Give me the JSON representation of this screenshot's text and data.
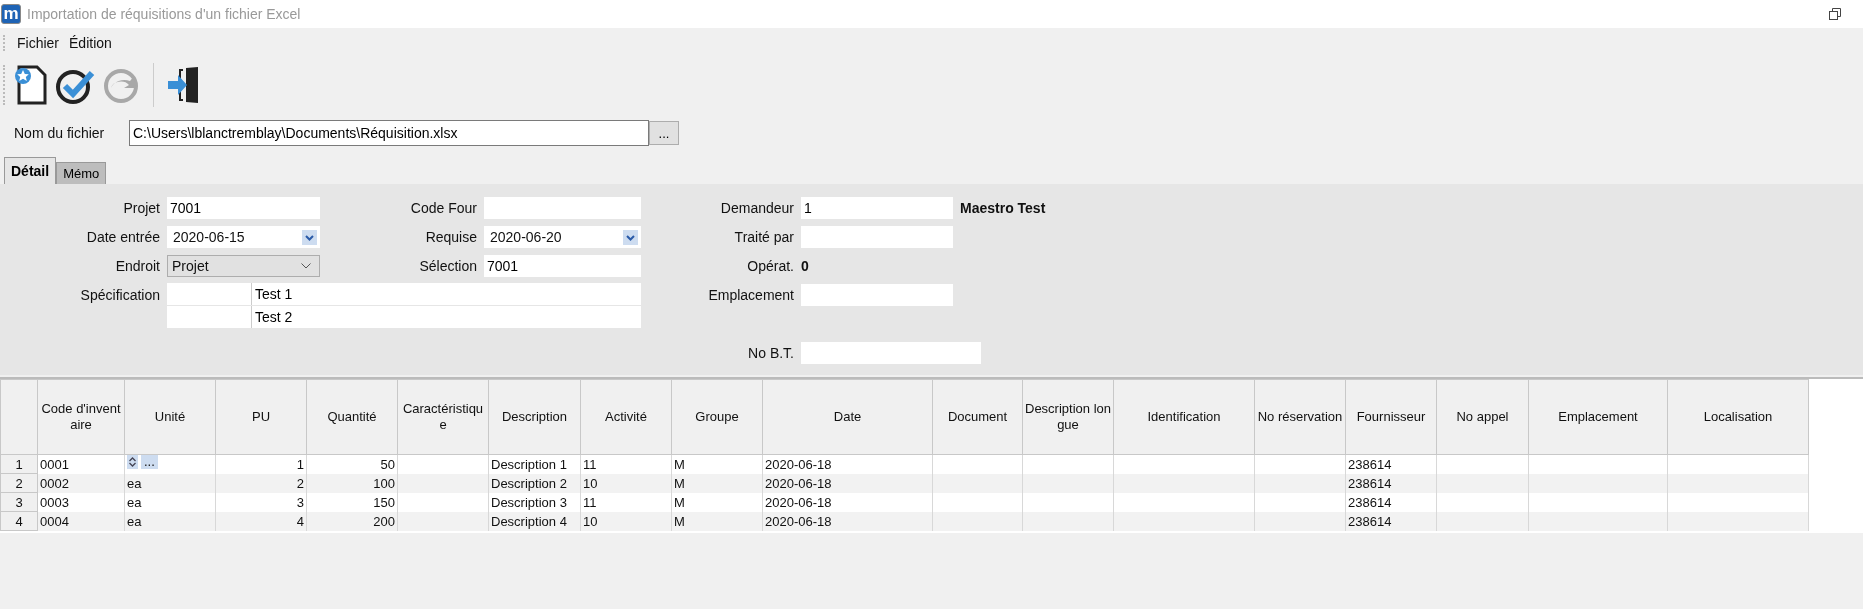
{
  "window": {
    "logo": "m",
    "title": "Importation de réquisitions d'un fichier Excel"
  },
  "menu": [
    "Fichier",
    "Édition"
  ],
  "toolbar": [
    {
      "kind": "new",
      "disabled": false
    },
    {
      "kind": "validate",
      "disabled": false
    },
    {
      "kind": "refresh",
      "disabled": true
    },
    {
      "kind": "exit",
      "disabled": false
    }
  ],
  "file": {
    "label": "Nom du fichier",
    "value": "C:\\Users\\lblanctremblay\\Documents\\Réquisition.xlsx",
    "browse": "..."
  },
  "tabs": [
    {
      "label": "Détail",
      "selected": true
    },
    {
      "label": "Mémo",
      "selected": false
    }
  ],
  "detail": {
    "projet": {
      "label": "Projet",
      "value": "7001"
    },
    "date_entree": {
      "label": "Date entrée",
      "value": "2020-06-15"
    },
    "endroit": {
      "label": "Endroit",
      "value": "Projet"
    },
    "specification": {
      "label": "Spécification",
      "lines": [
        "Test 1",
        "Test 2"
      ]
    },
    "code_four": {
      "label": "Code Four"
    },
    "requise": {
      "label": "Requise",
      "value": "2020-06-20"
    },
    "selection": {
      "label": "Sélection",
      "value": "7001"
    },
    "demandeur": {
      "label": "Demandeur",
      "value": "1",
      "name": "Maestro Test"
    },
    "traite_par": {
      "label": "Traité par"
    },
    "operat": {
      "label": "Opérat.",
      "value": "0"
    },
    "emplacement": {
      "label": "Emplacement"
    },
    "no_bt": {
      "label": "No B.T."
    }
  },
  "grid": {
    "editor_button": "...",
    "columns": [
      {
        "label": "Code d'inventaire",
        "kind": "text"
      },
      {
        "label": "Unité",
        "kind": "text"
      },
      {
        "label": "PU",
        "kind": "number"
      },
      {
        "label": "Quantité",
        "kind": "number"
      },
      {
        "label": "Caractéristique",
        "kind": "text"
      },
      {
        "label": "Description",
        "kind": "text"
      },
      {
        "label": "Activité",
        "kind": "text"
      },
      {
        "label": "Groupe",
        "kind": "text"
      },
      {
        "label": "Date",
        "kind": "text"
      },
      {
        "label": "Document",
        "kind": "text"
      },
      {
        "label": "Description longue",
        "kind": "text"
      },
      {
        "label": "Identification",
        "kind": "text"
      },
      {
        "label": "No réservation",
        "kind": "text"
      },
      {
        "label": "Fournisseur",
        "kind": "text"
      },
      {
        "label": "No appel",
        "kind": "text"
      },
      {
        "label": "Emplacement",
        "kind": "text"
      },
      {
        "label": "Localisation",
        "kind": "text"
      }
    ],
    "rows": [
      {
        "number": "1",
        "editing": true,
        "cells": [
          "0001",
          "",
          "1",
          "50",
          "",
          "Description 1",
          "11",
          "M",
          "2020-06-18",
          "",
          "",
          "",
          "",
          "238614",
          "",
          "",
          ""
        ]
      },
      {
        "number": "2",
        "editing": false,
        "cells": [
          "0002",
          "ea",
          "2",
          "100",
          "",
          "Description 2",
          "10",
          "M",
          "2020-06-18",
          "",
          "",
          "",
          "",
          "238614",
          "",
          "",
          ""
        ]
      },
      {
        "number": "3",
        "editing": false,
        "cells": [
          "0003",
          "ea",
          "3",
          "150",
          "",
          "Description 3",
          "11",
          "M",
          "2020-06-18",
          "",
          "",
          "",
          "",
          "238614",
          "",
          "",
          ""
        ]
      },
      {
        "number": "4",
        "editing": false,
        "cells": [
          "0004",
          "ea",
          "4",
          "200",
          "",
          "Description 4",
          "10",
          "M",
          "2020-06-18",
          "",
          "",
          "",
          "",
          "238614",
          "",
          "",
          ""
        ]
      }
    ]
  }
}
